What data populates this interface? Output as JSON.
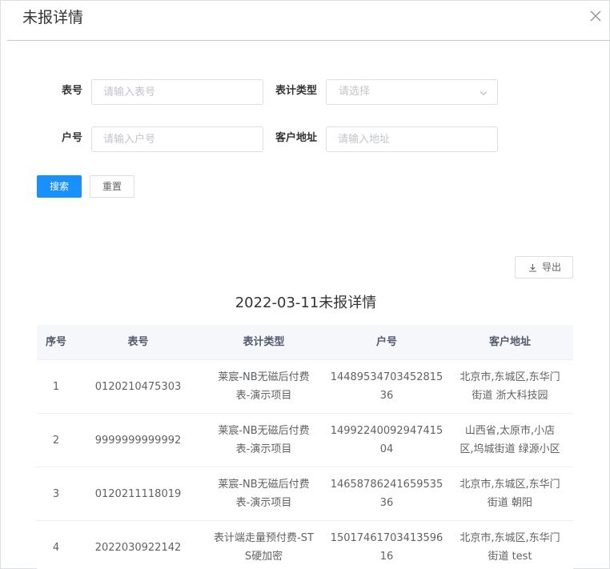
{
  "dialog": {
    "title": "未报详情",
    "close_icon": "close-icon"
  },
  "form": {
    "meter_no": {
      "label": "表号",
      "placeholder": "请输入表号"
    },
    "meter_type": {
      "label": "表计类型",
      "placeholder": "请选择"
    },
    "account_no": {
      "label": "户号",
      "placeholder": "请输入户号"
    },
    "address": {
      "label": "客户地址",
      "placeholder": "请输入地址"
    },
    "search_label": "搜索",
    "reset_label": "重置"
  },
  "toolbar": {
    "export_label": "导出",
    "export_icon": "download-icon"
  },
  "table": {
    "title": "2022-03-11未报详情",
    "columns": [
      "序号",
      "表号",
      "表计类型",
      "户号",
      "客户地址"
    ],
    "rows": [
      {
        "index": "1",
        "meter_no": "0120210475303",
        "type_l1": "莱宸-NB无磁后付费",
        "type_l2": "表-演示项目",
        "acct_l1": "14489534703452815",
        "acct_l2": "36",
        "addr_l1": "北京市,东城区,东华门",
        "addr_l2": "街道 浙大科技园"
      },
      {
        "index": "2",
        "meter_no": "9999999999992",
        "type_l1": "莱宸-NB无磁后付费",
        "type_l2": "表-演示项目",
        "acct_l1": "14992240092947415",
        "acct_l2": "04",
        "addr_l1": "山西省,太原市,小店",
        "addr_l2": "区,坞城街道 绿源小区"
      },
      {
        "index": "3",
        "meter_no": "0120211118019",
        "type_l1": "莱宸-NB无磁后付费",
        "type_l2": "表-演示项目",
        "acct_l1": "14658786241659535",
        "acct_l2": "36",
        "addr_l1": "北京市,东城区,东华门",
        "addr_l2": "街道 朝阳"
      },
      {
        "index": "4",
        "meter_no": "2022030922142",
        "type_l1": "表计端走量预付费-ST",
        "type_l2": "S硬加密",
        "acct_l1": "15017461703413596",
        "acct_l2": "16",
        "addr_l1": "北京市,东城区,东华门",
        "addr_l2": "街道 test"
      }
    ]
  }
}
